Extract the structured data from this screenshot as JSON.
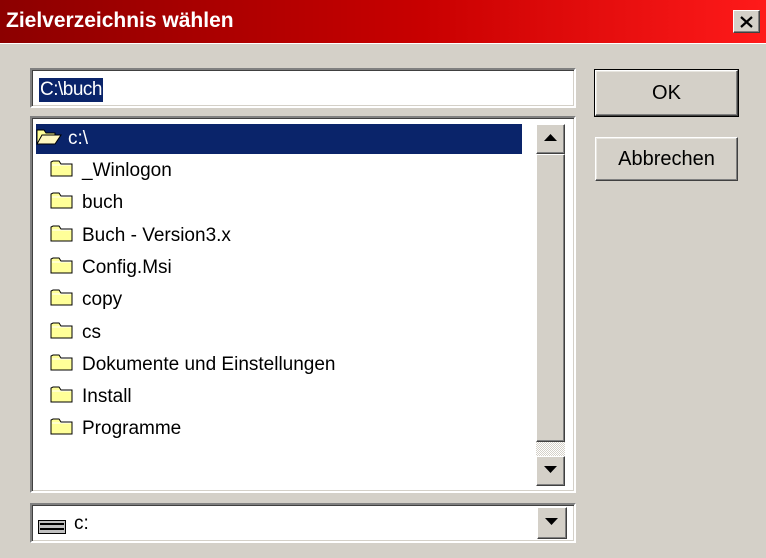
{
  "window": {
    "title": "Zielverzeichnis wählen",
    "close_icon": "close-icon"
  },
  "path_input": {
    "value": "C:\\buch"
  },
  "buttons": {
    "ok": "OK",
    "cancel": "Abbrechen"
  },
  "folder_list": {
    "root": {
      "label": "c:\\",
      "icon": "open-folder-icon",
      "selected": true
    },
    "items": [
      {
        "label": "_Winlogon",
        "icon": "folder-icon"
      },
      {
        "label": "buch",
        "icon": "folder-icon"
      },
      {
        "label": "Buch - Version3.x",
        "icon": "folder-icon"
      },
      {
        "label": "Config.Msi",
        "icon": "folder-icon"
      },
      {
        "label": "copy",
        "icon": "folder-icon"
      },
      {
        "label": "cs",
        "icon": "folder-icon"
      },
      {
        "label": "Dokumente und Einstellungen",
        "icon": "folder-icon"
      },
      {
        "label": "Install",
        "icon": "folder-icon"
      },
      {
        "label": "Programme",
        "icon": "folder-icon"
      }
    ]
  },
  "drive_select": {
    "value": "c:",
    "icon": "drive-icon"
  },
  "colors": {
    "title_gradient_start": "#8c0000",
    "title_gradient_end": "#ff1a1a",
    "selection": "#0a246a",
    "face": "#d4d0c8",
    "folder": "#ffff99"
  }
}
